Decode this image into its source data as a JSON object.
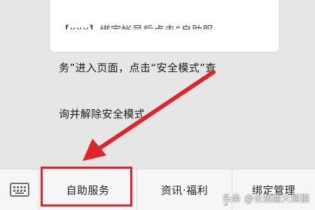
{
  "chat": {
    "bubble_partial_top": "【xxx】绑定帐号后点击“自助服",
    "bubble_line_1": "务”进入页面，点击“安全模式”查",
    "bubble_line_2": "询并解除安全模式。"
  },
  "bottom_menu": {
    "keyboard_icon": "keyboard-icon",
    "tabs": [
      {
        "label": "自助服务"
      },
      {
        "label": "资讯·福利"
      },
      {
        "label": "绑定管理"
      }
    ]
  },
  "annotation": {
    "highlight_color": "#e0242b",
    "arrow_color": "#e0242b"
  },
  "watermark": {
    "text": "头条 @长颈鹿大熊猫"
  }
}
